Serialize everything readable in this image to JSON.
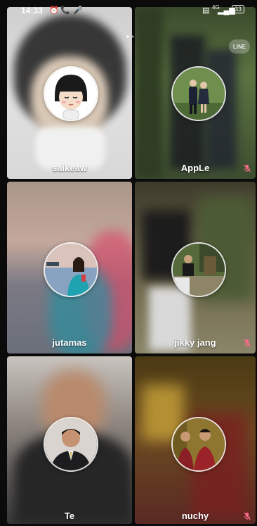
{
  "status_bar": {
    "time": "14:33",
    "battery": "33",
    "network": "4G"
  },
  "participants": [
    {
      "name": "saikeaw",
      "muted": false
    },
    {
      "name": "AppLe",
      "muted": true
    },
    {
      "name": "jutamas",
      "muted": false
    },
    {
      "name": "jikky jang",
      "muted": true
    },
    {
      "name": "Te",
      "muted": false
    },
    {
      "name": "nuchy",
      "muted": true
    }
  ],
  "app_logo": {
    "label": "LINE"
  },
  "colors": {
    "name_text": "#ffffff",
    "muted_icon": "#ff6b8a"
  }
}
